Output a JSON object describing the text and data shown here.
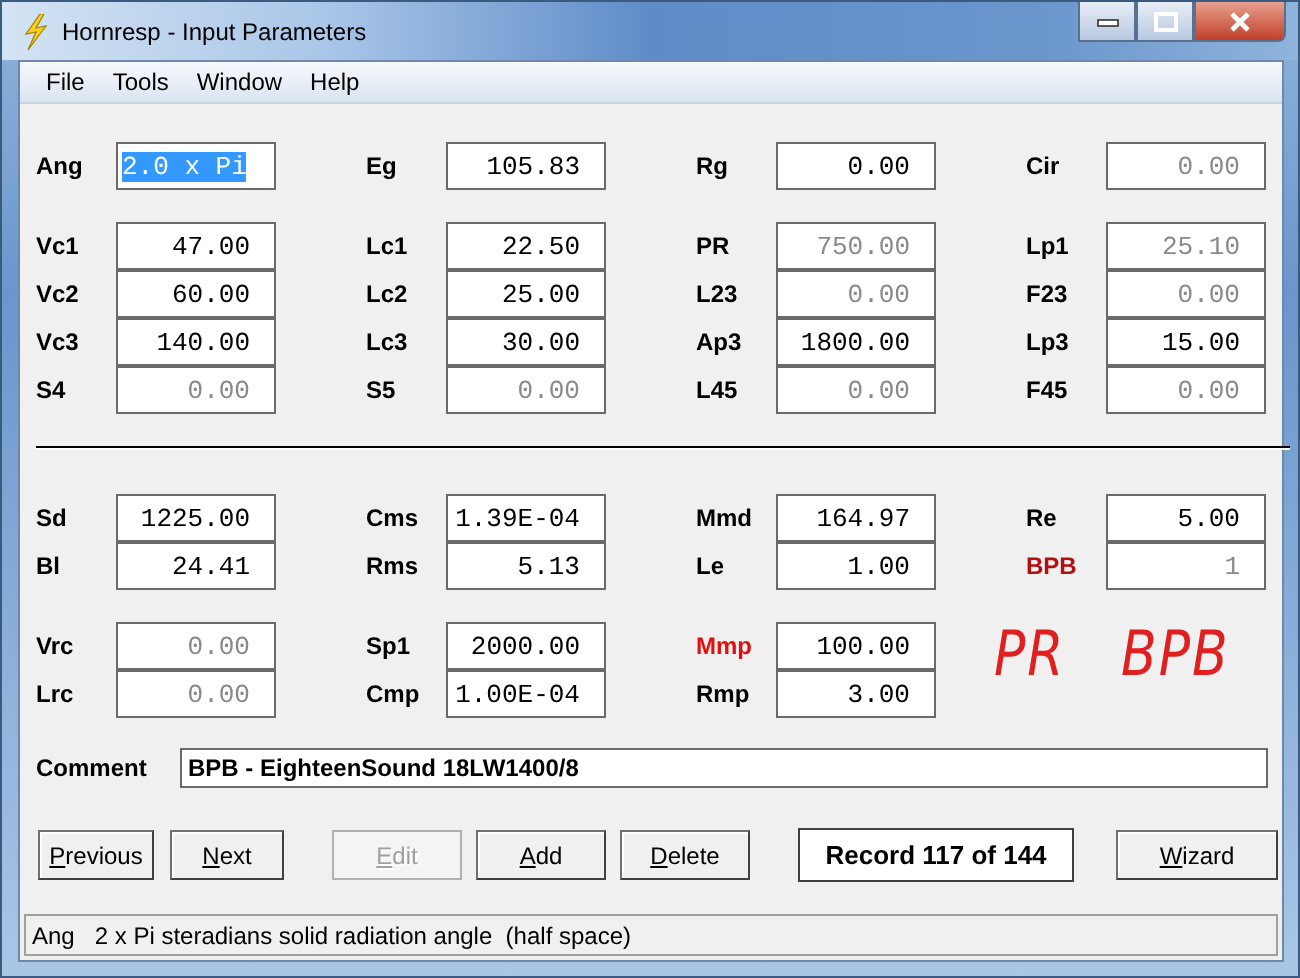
{
  "window": {
    "title": "Hornresp - Input Parameters"
  },
  "menu": [
    "File",
    "Tools",
    "Window",
    "Help"
  ],
  "sections": [
    {
      "kind": "fields",
      "rows": [
        [
          {
            "label": "Ang",
            "value": "2.0 x Pi",
            "color": "#000000",
            "disabled": false,
            "selected": true
          },
          {
            "label": "Eg",
            "value": "105.83",
            "color": "#000000",
            "disabled": false,
            "selected": false
          },
          {
            "label": "Rg",
            "value": "0.00",
            "color": "#000000",
            "disabled": false,
            "selected": false
          },
          {
            "label": "Cir",
            "value": "0.00",
            "color": "#000000",
            "disabled": true,
            "selected": false
          }
        ]
      ]
    },
    {
      "kind": "fields",
      "rows": [
        [
          {
            "label": "Vc1",
            "value": "47.00",
            "color": "#000000",
            "disabled": false,
            "selected": false
          },
          {
            "label": "Lc1",
            "value": "22.50",
            "color": "#000000",
            "disabled": false,
            "selected": false
          },
          {
            "label": "PR",
            "value": "750.00",
            "color": "#000000",
            "disabled": true,
            "selected": false
          },
          {
            "label": "Lp1",
            "value": "25.10",
            "color": "#000000",
            "disabled": true,
            "selected": false
          }
        ],
        [
          {
            "label": "Vc2",
            "value": "60.00",
            "color": "#000000",
            "disabled": false,
            "selected": false
          },
          {
            "label": "Lc2",
            "value": "25.00",
            "color": "#000000",
            "disabled": false,
            "selected": false
          },
          {
            "label": "L23",
            "value": "0.00",
            "color": "#000000",
            "disabled": true,
            "selected": false
          },
          {
            "label": "F23",
            "value": "0.00",
            "color": "#000000",
            "disabled": true,
            "selected": false
          }
        ],
        [
          {
            "label": "Vc3",
            "value": "140.00",
            "color": "#000000",
            "disabled": false,
            "selected": false
          },
          {
            "label": "Lc3",
            "value": "30.00",
            "color": "#000000",
            "disabled": false,
            "selected": false
          },
          {
            "label": "Ap3",
            "value": "1800.00",
            "color": "#000000",
            "disabled": false,
            "selected": false
          },
          {
            "label": "Lp3",
            "value": "15.00",
            "color": "#000000",
            "disabled": false,
            "selected": false
          }
        ],
        [
          {
            "label": "S4",
            "value": "0.00",
            "color": "#000000",
            "disabled": true,
            "selected": false
          },
          {
            "label": "S5",
            "value": "0.00",
            "color": "#000000",
            "disabled": true,
            "selected": false
          },
          {
            "label": "L45",
            "value": "0.00",
            "color": "#000000",
            "disabled": true,
            "selected": false
          },
          {
            "label": "F45",
            "value": "0.00",
            "color": "#000000",
            "disabled": true,
            "selected": false
          }
        ]
      ]
    },
    {
      "kind": "divider"
    },
    {
      "kind": "fields",
      "rows": [
        [
          {
            "label": "Sd",
            "value": "1225.00",
            "color": "#000000",
            "disabled": false,
            "selected": false
          },
          {
            "label": "Cms",
            "value": "1.39E-04",
            "color": "#000000",
            "disabled": false,
            "selected": false
          },
          {
            "label": "Mmd",
            "value": "164.97",
            "color": "#000000",
            "disabled": false,
            "selected": false
          },
          {
            "label": "Re",
            "value": "5.00",
            "color": "#000000",
            "disabled": false,
            "selected": false
          }
        ],
        [
          {
            "label": "Bl",
            "value": "24.41",
            "color": "#000000",
            "disabled": false,
            "selected": false
          },
          {
            "label": "Rms",
            "value": "5.13",
            "color": "#000000",
            "disabled": false,
            "selected": false
          },
          {
            "label": "Le",
            "value": "1.00",
            "color": "#000000",
            "disabled": false,
            "selected": false
          },
          {
            "label": "BPB",
            "value": "1",
            "color": "#b01010",
            "disabled": true,
            "selected": false
          }
        ]
      ]
    },
    {
      "kind": "fields",
      "rows": [
        [
          {
            "label": "Vrc",
            "value": "0.00",
            "color": "#000000",
            "disabled": true,
            "selected": false
          },
          {
            "label": "Sp1",
            "value": "2000.00",
            "color": "#000000",
            "disabled": false,
            "selected": false
          },
          {
            "label": "Mmp",
            "value": "100.00",
            "color": "#e01010",
            "disabled": false,
            "selected": false
          }
        ],
        [
          {
            "label": "Lrc",
            "value": "0.00",
            "color": "#000000",
            "disabled": true,
            "selected": false
          },
          {
            "label": "Cmp",
            "value": "1.00E-04",
            "color": "#000000",
            "disabled": false,
            "selected": false
          },
          {
            "label": "Rmp",
            "value": "3.00",
            "color": "#000000",
            "disabled": false,
            "selected": false
          }
        ]
      ]
    }
  ],
  "annotation": "PR   BPB",
  "comment": {
    "label": "Comment",
    "value": "BPB - EighteenSound 18LW1400/8"
  },
  "buttons": [
    {
      "label": "Previous",
      "kind": "button",
      "disabled": false
    },
    {
      "label": "Next",
      "kind": "button",
      "disabled": false
    },
    {
      "label": "Edit",
      "kind": "button",
      "disabled": true
    },
    {
      "label": "Add",
      "kind": "button",
      "disabled": false
    },
    {
      "label": "Delete",
      "kind": "button",
      "disabled": false
    },
    {
      "label": "Record 117 of 144",
      "kind": "display"
    },
    {
      "label": "Wizard",
      "kind": "button",
      "disabled": false
    }
  ],
  "status_bar": "Ang   2 x Pi steradians solid radiation angle  (half space)"
}
